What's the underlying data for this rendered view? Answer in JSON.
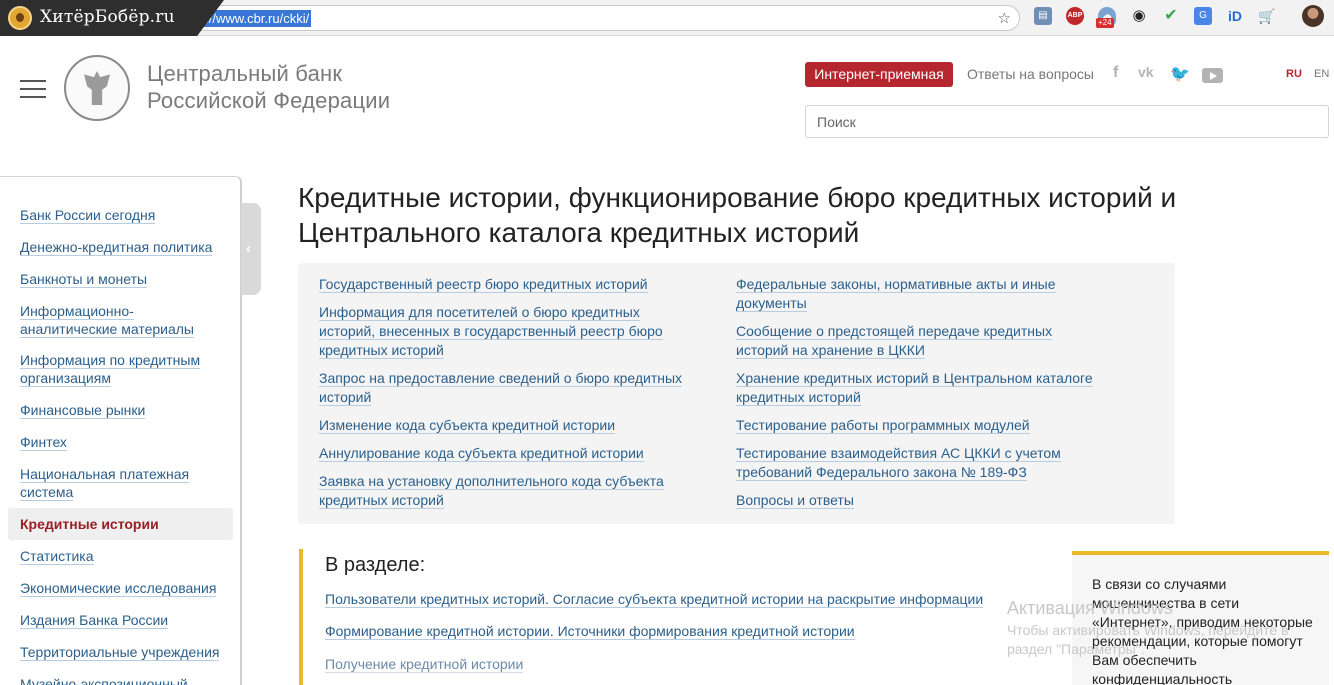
{
  "browser": {
    "watermark_text": "ХитёрБобёр.ru",
    "url": "https://www.cbr.ru/ckki/",
    "extensions": {
      "abp": "ABP",
      "badge": "+24",
      "id": "iD"
    }
  },
  "header": {
    "bank_name_line1": "Центральный банк",
    "bank_name_line2": "Российской Федерации",
    "reception": "Интернет-приемная",
    "faq": "Ответы на вопросы",
    "lang_ru": "RU",
    "lang_en": "EN",
    "search_placeholder": "Поиск"
  },
  "sidebar": {
    "items": [
      "Банк России сегодня",
      "Денежно-кредитная политика",
      "Банкноты и монеты",
      "Информационно-аналитические материалы",
      "Информация по кредитным организациям",
      "Финансовые рынки",
      "Финтех",
      "Национальная платежная система",
      "Кредитные истории",
      "Статистика",
      "Экономические исследования",
      "Издания Банка России",
      "Территориальные учреждения",
      "Музейно-экспозиционный"
    ],
    "active_index": 8
  },
  "main": {
    "title": "Кредитные истории, функционирование бюро кредитных историй и Центрального каталога кредитных историй",
    "links_left": [
      "Государственный реестр бюро кредитных историй",
      "Информация для посетителей о бюро кредитных историй, внесенных в государственный реестр бюро кредитных историй",
      "Запрос на предоставление сведений о бюро кредитных историй",
      "Изменение кода субъекта кредитной истории",
      "Аннулирование кода субъекта кредитной истории",
      "Заявка на установку дополнительного кода субъекта кредитных историй"
    ],
    "links_right": [
      "Федеральные законы, нормативные акты и иные документы",
      "Сообщение о предстоящей передаче кредитных историй на хранение в ЦККИ",
      "Хранение кредитных историй в Центральном каталоге кредитных историй",
      "Тестирование работы программных модулей",
      "Тестирование взаимодействия АС ЦККИ с учетом требований Федерального закона № 189-ФЗ",
      "Вопросы и ответы"
    ],
    "section_title": "В разделе:",
    "section_links": [
      "Пользователи кредитных историй. Согласие субъекта кредитной истории на раскрытие информации",
      "Формирование кредитной истории. Источники формирования кредитной истории",
      "Получение кредитной истории"
    ]
  },
  "notice": {
    "text": "В связи со случаями мошенничества в сети «Интернет», приводим некоторые рекомендации, которые помогут Вам обеспечить конфиденциальность"
  },
  "activation": {
    "line1": "Активация Windows",
    "line2": "Чтобы активировать Windows, перейдите в раздел \"Параметры\"."
  }
}
